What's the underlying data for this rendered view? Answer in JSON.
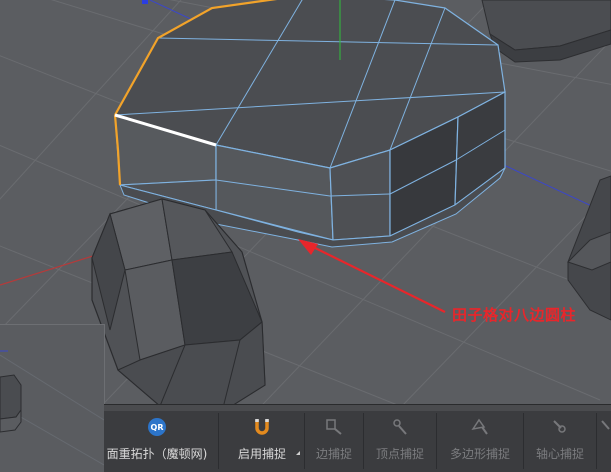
{
  "annotation": {
    "label": "田子格对八边圆柱"
  },
  "toolbar": {
    "items": [
      {
        "label": "面重拓扑（魔顿网)",
        "icon": "qr-icon",
        "enabled": true
      },
      {
        "label": "启用捕捉",
        "icon": "magnet-icon",
        "enabled": true
      },
      {
        "label": "边捕捉",
        "icon": "edge-snap-icon",
        "enabled": false
      },
      {
        "label": "顶点捕捉",
        "icon": "vertex-snap-icon",
        "enabled": false
      },
      {
        "label": "多边形捕捉",
        "icon": "polygon-snap-icon",
        "enabled": false
      },
      {
        "label": "轴心捕捉",
        "icon": "axis-snap-icon",
        "enabled": false
      }
    ],
    "qr_badge": "QR"
  },
  "colors": {
    "viewport_bg": "#5b5d61",
    "grid_line": "#6b6d71",
    "mesh_face": "#4a4c50",
    "wire_blue": "#7fb2e0",
    "selected_edge_orange": "#f2a32a",
    "active_edge_white": "#ffffff",
    "annotation_red": "#e8262b",
    "toolbar_bg": "#3b3c3f"
  }
}
